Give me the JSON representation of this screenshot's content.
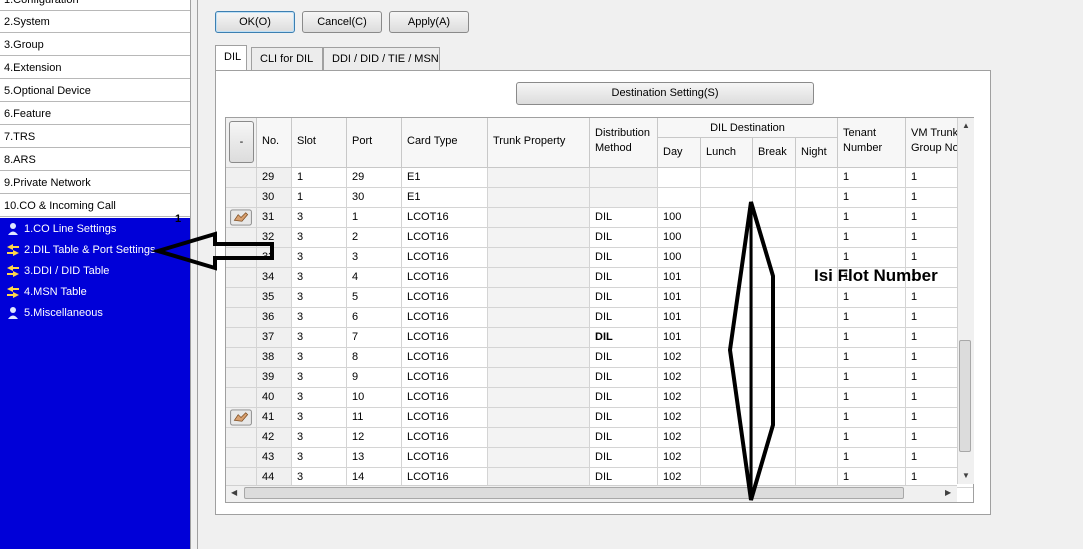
{
  "nav": {
    "items": [
      "1.Configuration",
      "2.System",
      "3.Group",
      "4.Extension",
      "5.Optional Device",
      "6.Feature",
      "7.TRS",
      "8.ARS",
      "9.Private Network",
      "10.CO & Incoming Call"
    ],
    "subitems": [
      "1.CO Line Settings",
      "2.DIL Table & Port Settings",
      "3.DDI / DID Table",
      "4.MSN Table",
      "5.Miscellaneous"
    ]
  },
  "toolbar": {
    "ok": "OK(O)",
    "cancel": "Cancel(C)",
    "apply": "Apply(A)"
  },
  "tabs": [
    "DIL",
    "CLI for DIL",
    "DDI / DID / TIE / MSN"
  ],
  "destination_button": "Destination Setting(S)",
  "table": {
    "corner": "-",
    "group_header": "DIL Destination",
    "headers": {
      "no": "No.",
      "slot": "Slot",
      "port": "Port",
      "card": "Card Type",
      "trunk": "Trunk Property",
      "dist1": "Distribution",
      "dist2": "Method",
      "day": "Day",
      "lunch": "Lunch",
      "break": "Break",
      "night": "Night",
      "tenant1": "Tenant",
      "tenant2": "Number",
      "vm1": "VM Trunk",
      "vm2": "Group No"
    },
    "rows": [
      {
        "no": "29",
        "slot": "1",
        "port": "29",
        "card": "E1",
        "method": "",
        "day": "",
        "tenant": "1",
        "vm": "1"
      },
      {
        "no": "30",
        "slot": "1",
        "port": "30",
        "card": "E1",
        "method": "",
        "day": "",
        "tenant": "1",
        "vm": "1"
      },
      {
        "no": "31",
        "slot": "3",
        "port": "1",
        "card": "LCOT16",
        "method": "DIL",
        "day": "100",
        "tenant": "1",
        "vm": "1"
      },
      {
        "no": "32",
        "slot": "3",
        "port": "2",
        "card": "LCOT16",
        "method": "DIL",
        "day": "100",
        "tenant": "1",
        "vm": "1"
      },
      {
        "no": "33",
        "slot": "3",
        "port": "3",
        "card": "LCOT16",
        "method": "DIL",
        "day": "100",
        "tenant": "1",
        "vm": "1"
      },
      {
        "no": "34",
        "slot": "3",
        "port": "4",
        "card": "LCOT16",
        "method": "DIL",
        "day": "101",
        "tenant": "1",
        "vm": "1"
      },
      {
        "no": "35",
        "slot": "3",
        "port": "5",
        "card": "LCOT16",
        "method": "DIL",
        "day": "101",
        "tenant": "1",
        "vm": "1"
      },
      {
        "no": "36",
        "slot": "3",
        "port": "6",
        "card": "LCOT16",
        "method": "DIL",
        "day": "101",
        "tenant": "1",
        "vm": "1"
      },
      {
        "no": "37",
        "slot": "3",
        "port": "7",
        "card": "LCOT16",
        "method": "DIL",
        "day": "101",
        "tenant": "1",
        "vm": "1"
      },
      {
        "no": "38",
        "slot": "3",
        "port": "8",
        "card": "LCOT16",
        "method": "DIL",
        "day": "102",
        "tenant": "1",
        "vm": "1"
      },
      {
        "no": "39",
        "slot": "3",
        "port": "9",
        "card": "LCOT16",
        "method": "DIL",
        "day": "102",
        "tenant": "1",
        "vm": "1"
      },
      {
        "no": "40",
        "slot": "3",
        "port": "10",
        "card": "LCOT16",
        "method": "DIL",
        "day": "102",
        "tenant": "1",
        "vm": "1"
      },
      {
        "no": "41",
        "slot": "3",
        "port": "11",
        "card": "LCOT16",
        "method": "DIL",
        "day": "102",
        "tenant": "1",
        "vm": "1"
      },
      {
        "no": "42",
        "slot": "3",
        "port": "12",
        "card": "LCOT16",
        "method": "DIL",
        "day": "102",
        "tenant": "1",
        "vm": "1"
      },
      {
        "no": "43",
        "slot": "3",
        "port": "13",
        "card": "LCOT16",
        "method": "DIL",
        "day": "102",
        "tenant": "1",
        "vm": "1"
      },
      {
        "no": "44",
        "slot": "3",
        "port": "14",
        "card": "LCOT16",
        "method": "DIL",
        "day": "102",
        "tenant": "1",
        "vm": "1"
      }
    ]
  },
  "annotations": {
    "label": "Isi Flot Number",
    "marker": "1"
  },
  "colors": {
    "subnav_bg": "#0000d8",
    "panel_bg": "#f0f0f0"
  }
}
